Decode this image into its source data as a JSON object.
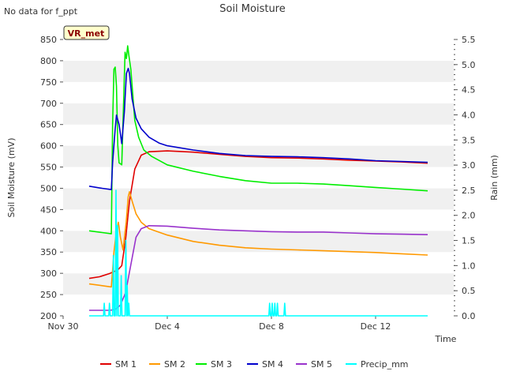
{
  "chart_data": {
    "type": "line",
    "title": "Soil Moisture",
    "note": "No data for f_ppt",
    "badge": "VR_met",
    "xlabel": "Time",
    "ylabel": "Soil Moisture (mV)",
    "y2label": "Rain (mm)",
    "xlim": [
      0,
      15
    ],
    "ylim": [
      200,
      850
    ],
    "y2lim": [
      0,
      5.5
    ],
    "x_ticks": [
      {
        "value": 0,
        "label": "Nov 30"
      },
      {
        "value": 4,
        "label": "Dec 4"
      },
      {
        "value": 8,
        "label": "Dec 8"
      },
      {
        "value": 12,
        "label": "Dec 12"
      }
    ],
    "y_ticks": [
      "200",
      "250",
      "300",
      "350",
      "400",
      "450",
      "500",
      "550",
      "600",
      "650",
      "700",
      "750",
      "800",
      "850"
    ],
    "y2_ticks": [
      "0.0",
      "0.5",
      "1.0",
      "1.5",
      "2.0",
      "2.5",
      "3.0",
      "3.5",
      "4.0",
      "4.5",
      "5.0",
      "5.5"
    ],
    "grid": "horizontal alternating bands",
    "legend_position": "bottom",
    "series": [
      {
        "name": "SM 1",
        "color": "#e00000",
        "axis": "left",
        "points": [
          [
            1.0,
            288
          ],
          [
            1.4,
            292
          ],
          [
            1.8,
            300
          ],
          [
            2.1,
            308
          ],
          [
            2.25,
            318
          ],
          [
            2.4,
            380
          ],
          [
            2.55,
            470
          ],
          [
            2.75,
            545
          ],
          [
            3.0,
            578
          ],
          [
            3.3,
            586
          ],
          [
            4.0,
            588
          ],
          [
            5.0,
            585
          ],
          [
            6.0,
            580
          ],
          [
            7.0,
            575
          ],
          [
            8.0,
            572
          ],
          [
            9.0,
            571
          ],
          [
            10.0,
            569
          ],
          [
            11.0,
            566
          ],
          [
            12.0,
            564
          ],
          [
            13.0,
            562
          ],
          [
            14.0,
            559
          ]
        ]
      },
      {
        "name": "SM 2",
        "color": "#ff9900",
        "axis": "left",
        "points": [
          [
            1.0,
            275
          ],
          [
            1.5,
            271
          ],
          [
            1.85,
            268
          ],
          [
            1.95,
            350
          ],
          [
            2.05,
            400
          ],
          [
            2.12,
            420
          ],
          [
            2.2,
            385
          ],
          [
            2.3,
            355
          ],
          [
            2.42,
            420
          ],
          [
            2.5,
            480
          ],
          [
            2.55,
            492
          ],
          [
            2.65,
            470
          ],
          [
            2.8,
            440
          ],
          [
            3.0,
            420
          ],
          [
            3.3,
            405
          ],
          [
            4.0,
            390
          ],
          [
            5.0,
            375
          ],
          [
            6.0,
            366
          ],
          [
            7.0,
            360
          ],
          [
            8.0,
            357
          ],
          [
            9.0,
            355
          ],
          [
            10.0,
            353
          ],
          [
            11.0,
            351
          ],
          [
            12.0,
            349
          ],
          [
            13.0,
            346
          ],
          [
            14.0,
            343
          ]
        ]
      },
      {
        "name": "SM 3",
        "color": "#00ee00",
        "axis": "left",
        "points": [
          [
            1.0,
            400
          ],
          [
            1.5,
            396
          ],
          [
            1.85,
            393
          ],
          [
            1.9,
            650
          ],
          [
            1.95,
            780
          ],
          [
            2.0,
            785
          ],
          [
            2.05,
            740
          ],
          [
            2.1,
            600
          ],
          [
            2.15,
            560
          ],
          [
            2.25,
            555
          ],
          [
            2.32,
            700
          ],
          [
            2.38,
            820
          ],
          [
            2.43,
            805
          ],
          [
            2.48,
            835
          ],
          [
            2.53,
            810
          ],
          [
            2.6,
            780
          ],
          [
            2.75,
            660
          ],
          [
            2.9,
            620
          ],
          [
            3.1,
            590
          ],
          [
            3.4,
            575
          ],
          [
            4.0,
            555
          ],
          [
            5.0,
            540
          ],
          [
            6.0,
            528
          ],
          [
            7.0,
            518
          ],
          [
            8.0,
            512
          ],
          [
            9.0,
            512
          ],
          [
            10.0,
            510
          ],
          [
            11.0,
            506
          ],
          [
            12.0,
            502
          ],
          [
            13.0,
            498
          ],
          [
            14.0,
            494
          ]
        ]
      },
      {
        "name": "SM 4",
        "color": "#0000cc",
        "axis": "left",
        "points": [
          [
            1.0,
            505
          ],
          [
            1.5,
            500
          ],
          [
            1.85,
            497
          ],
          [
            1.9,
            560
          ],
          [
            2.0,
            640
          ],
          [
            2.05,
            672
          ],
          [
            2.15,
            650
          ],
          [
            2.25,
            605
          ],
          [
            2.35,
            680
          ],
          [
            2.43,
            770
          ],
          [
            2.5,
            782
          ],
          [
            2.55,
            770
          ],
          [
            2.65,
            710
          ],
          [
            2.8,
            665
          ],
          [
            3.0,
            640
          ],
          [
            3.3,
            620
          ],
          [
            3.7,
            606
          ],
          [
            4.0,
            600
          ],
          [
            5.0,
            590
          ],
          [
            6.0,
            582
          ],
          [
            7.0,
            577
          ],
          [
            8.0,
            575
          ],
          [
            9.0,
            574
          ],
          [
            10.0,
            572
          ],
          [
            11.0,
            569
          ],
          [
            12.0,
            565
          ],
          [
            13.0,
            563
          ],
          [
            14.0,
            561
          ]
        ]
      },
      {
        "name": "SM 5",
        "color": "#9933cc",
        "axis": "left",
        "points": [
          [
            1.0,
            213
          ],
          [
            1.5,
            213
          ],
          [
            1.8,
            213
          ],
          [
            2.0,
            215
          ],
          [
            2.2,
            225
          ],
          [
            2.4,
            255
          ],
          [
            2.6,
            320
          ],
          [
            2.8,
            385
          ],
          [
            3.0,
            405
          ],
          [
            3.3,
            412
          ],
          [
            4.0,
            411
          ],
          [
            5.0,
            406
          ],
          [
            6.0,
            402
          ],
          [
            7.0,
            400
          ],
          [
            8.0,
            398
          ],
          [
            9.0,
            397
          ],
          [
            10.0,
            397
          ],
          [
            11.0,
            395
          ],
          [
            12.0,
            393
          ],
          [
            13.0,
            392
          ],
          [
            14.0,
            391
          ]
        ]
      },
      {
        "name": "Precip_mm",
        "color": "#00ffff",
        "axis": "right",
        "points": [
          [
            1.0,
            0
          ],
          [
            1.55,
            0
          ],
          [
            1.58,
            0.25
          ],
          [
            1.61,
            0
          ],
          [
            1.75,
            0
          ],
          [
            1.78,
            0.25
          ],
          [
            1.81,
            0
          ],
          [
            1.9,
            0
          ],
          [
            1.93,
            1.2
          ],
          [
            1.96,
            0
          ],
          [
            2.0,
            0
          ],
          [
            2.03,
            2.5
          ],
          [
            2.06,
            0
          ],
          [
            2.09,
            1.8
          ],
          [
            2.12,
            0
          ],
          [
            2.2,
            0
          ],
          [
            2.23,
            0.8
          ],
          [
            2.26,
            0
          ],
          [
            2.38,
            0
          ],
          [
            2.41,
            1.5
          ],
          [
            2.44,
            0
          ],
          [
            2.46,
            0.6
          ],
          [
            2.49,
            0
          ],
          [
            2.52,
            0.25
          ],
          [
            2.55,
            0
          ],
          [
            7.9,
            0
          ],
          [
            7.93,
            0.25
          ],
          [
            7.96,
            0
          ],
          [
            8.0,
            0
          ],
          [
            8.03,
            0.25
          ],
          [
            8.06,
            0
          ],
          [
            8.1,
            0
          ],
          [
            8.13,
            0.25
          ],
          [
            8.16,
            0
          ],
          [
            8.2,
            0
          ],
          [
            8.23,
            0.25
          ],
          [
            8.26,
            0
          ],
          [
            8.48,
            0
          ],
          [
            8.51,
            0.25
          ],
          [
            8.54,
            0
          ],
          [
            14.0,
            0
          ]
        ]
      }
    ]
  }
}
